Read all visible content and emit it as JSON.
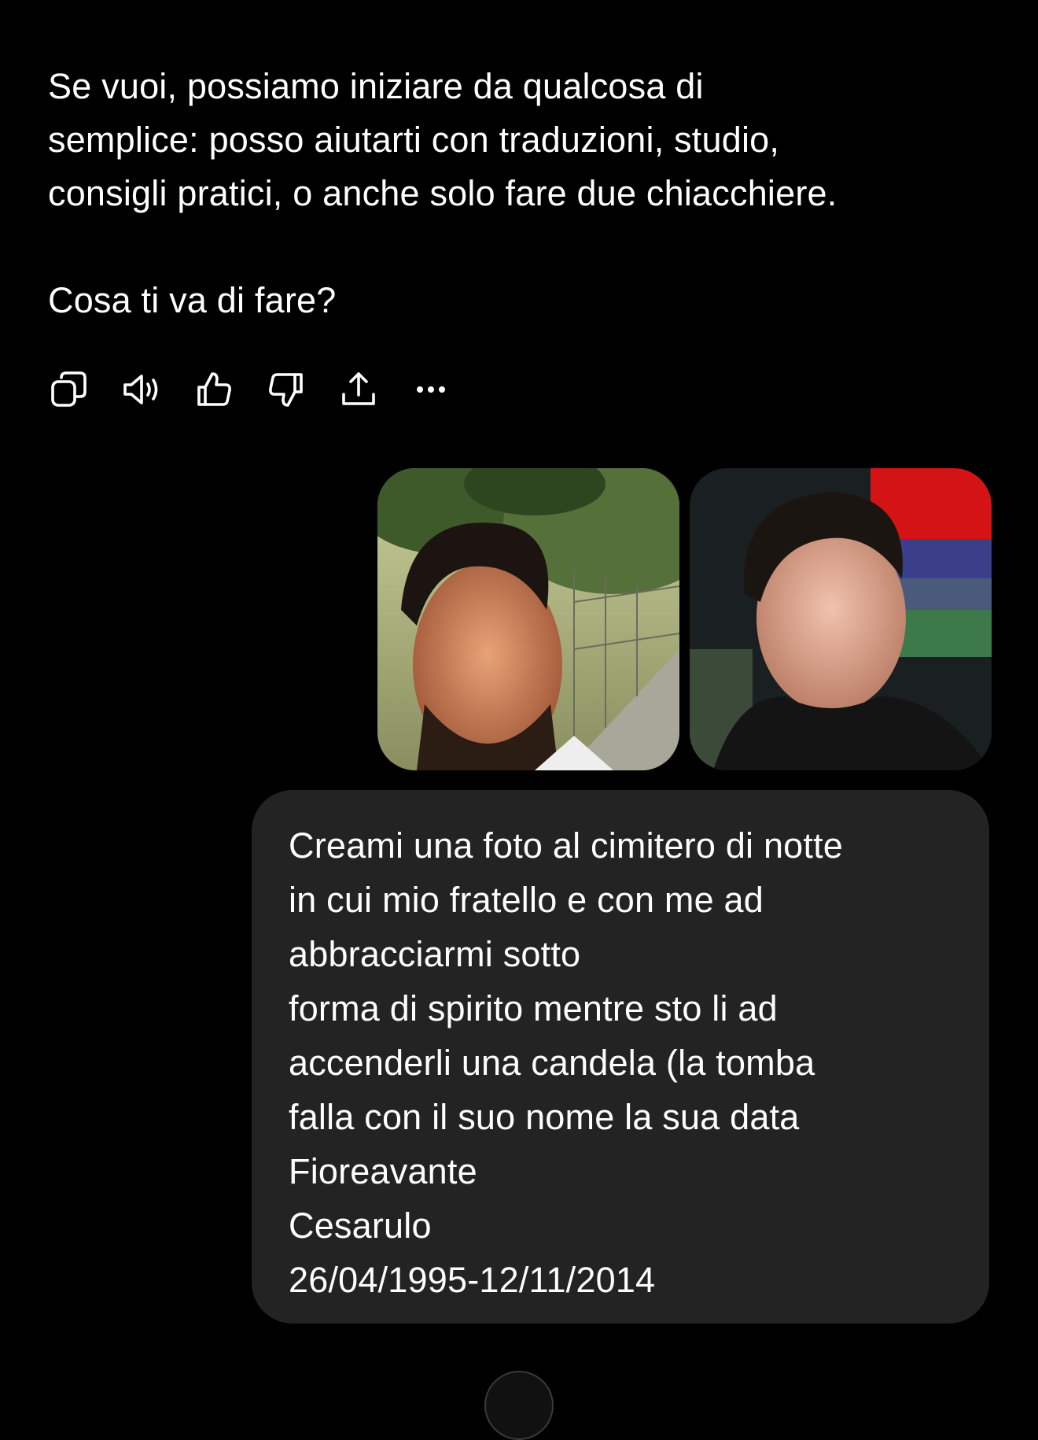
{
  "assistant_message": {
    "paragraph_1": [
      "Se vuoi, possiamo iniziare da qualcosa di",
      "semplice: posso aiutarti con traduzioni, studio,",
      "consigli pratici, o anche solo fare due chiacchiere."
    ],
    "paragraph_2": "Cosa ti va di fare?"
  },
  "action_bar": [
    {
      "name": "copy-icon"
    },
    {
      "name": "read-aloud-icon"
    },
    {
      "name": "thumbs-up-icon"
    },
    {
      "name": "thumbs-down-icon"
    },
    {
      "name": "share-icon"
    },
    {
      "name": "more-options-icon"
    }
  ],
  "user_images": [
    {
      "name": "attached-photo-1"
    },
    {
      "name": "attached-photo-2"
    }
  ],
  "user_message": {
    "lines": [
      "Creami una foto al cimitero di notte",
      "in cui mio fratello e con me ad",
      "abbracciarmi sotto",
      "forma di spirito mentre sto li ad",
      "accenderli una candela (la tomba",
      "falla con il suo nome la sua data",
      "Fioreavante",
      "Cesarulo",
      "26/04/1995-12/11/2014"
    ]
  },
  "colors": {
    "background": "#000000",
    "text": "#ffffff",
    "user_bubble": "#232323"
  }
}
